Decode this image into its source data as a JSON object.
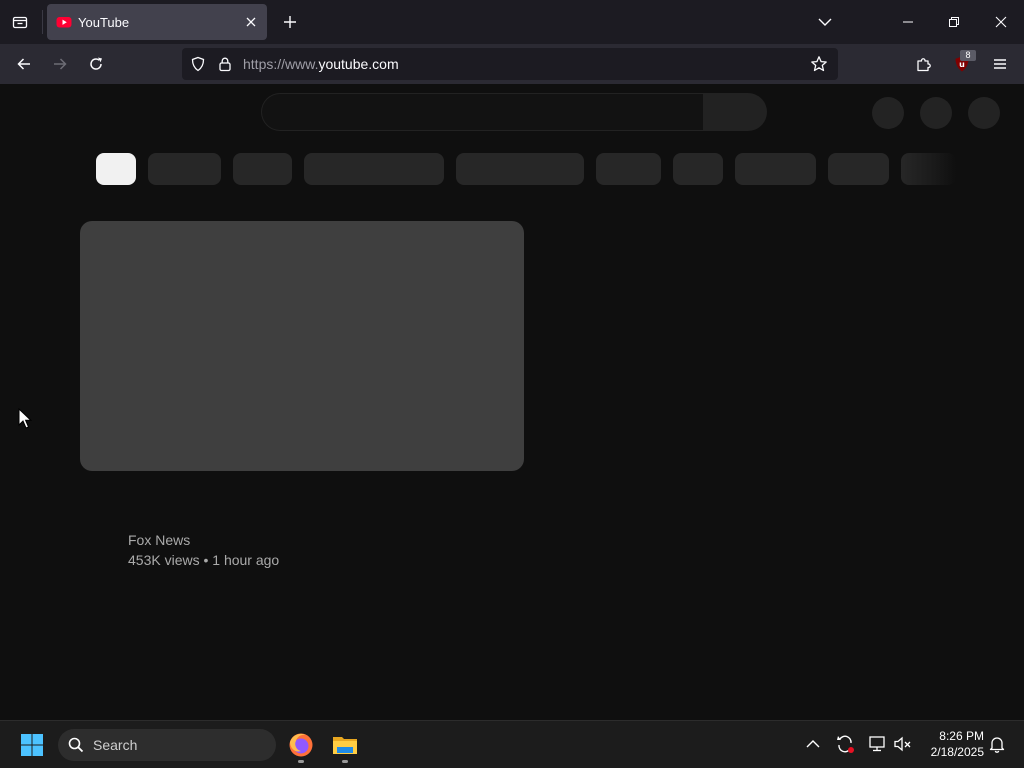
{
  "browser": {
    "tab": {
      "title": "YouTube",
      "active": true
    },
    "url": {
      "prefix": "https://www.",
      "domain": "youtube.com"
    },
    "extension_badge": "8",
    "icons": {
      "tab_list": "tab-list-icon",
      "favicon": "youtube-favicon-icon",
      "close_tab": "close-icon",
      "new_tab": "plus-icon",
      "list_all_tabs": "chevron-down-icon",
      "minimize": "minimize-icon",
      "restore": "restore-icon",
      "close_window": "close-icon",
      "back": "arrow-left-icon",
      "forward": "arrow-right-icon",
      "reload": "reload-icon",
      "tracking_protection": "shield-icon",
      "lock": "lock-icon",
      "bookmark": "star-icon",
      "extensions": "puzzle-icon",
      "ublock": "ublock-icon",
      "menu": "hamburger-icon"
    }
  },
  "page": {
    "video": {
      "channel": "Fox News",
      "stats": "453K views • 1 hour ago"
    }
  },
  "taskbar": {
    "search_label": "Search",
    "clock": {
      "time": "8:26 PM",
      "date": "2/18/2025"
    },
    "apps": [
      "Firefox",
      "File Explorer"
    ]
  },
  "colors": {
    "page_bg": "#0f0f0f",
    "tabbar_bg": "#1c1b22",
    "navbar_bg": "#2b2a33",
    "skeleton": "#272727",
    "thumbnail": "#3f3f3f",
    "active_chip": "#f1f1f1",
    "meta_text": "#aaaaaa",
    "youtube_red": "#ff0033"
  }
}
